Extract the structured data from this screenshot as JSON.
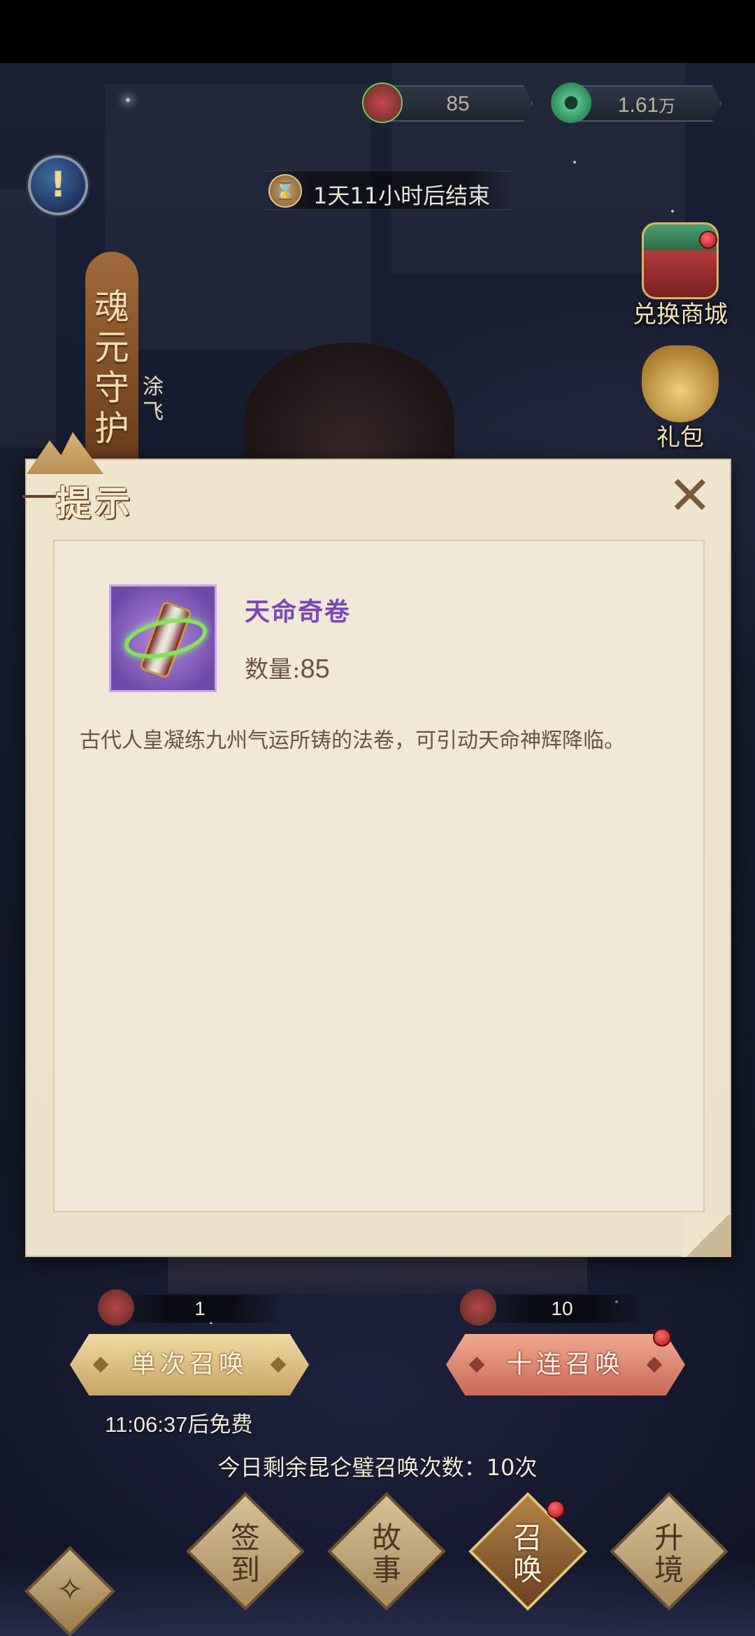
{
  "resources": {
    "scroll_count": "85",
    "jade_amount": "1.61",
    "jade_unit": "万",
    "scroll_icon": "scroll-icon",
    "jade_icon": "jade-coin-icon"
  },
  "info_button": {
    "glyph": "!"
  },
  "event_timer": {
    "text": "1天11小时后结束",
    "icon": "hourglass-icon",
    "icon_glyph": "⌛"
  },
  "side_buttons": {
    "exchange_shop": {
      "label": "兑换商城",
      "icon": "treasure-chest-icon"
    },
    "gift_pack": {
      "label": "礼包",
      "icon": "money-bag-icon"
    }
  },
  "hero": {
    "banner_title": "魂元守护",
    "sub_name": "涂飞"
  },
  "dialog": {
    "title": "提示",
    "close_glyph": "✕",
    "item": {
      "name": "天命奇卷",
      "quantity_label": "数量:",
      "quantity_value": "85",
      "icon": "destiny-scroll-icon",
      "description": "古代人皇凝练九州气运所铸的法卷，可引动天命神辉降临。"
    }
  },
  "summon": {
    "single": {
      "cost": "1",
      "label": "单次召唤",
      "free_timer": "11:06:37后免费"
    },
    "ten": {
      "cost": "10",
      "label": "十连召唤"
    },
    "remaining_text": "今日剩余昆仑璧召唤次数：10次"
  },
  "bottom_nav": {
    "back_glyph": "✧",
    "items": [
      {
        "label_top": "签",
        "label_bottom": "到",
        "active": false
      },
      {
        "label_top": "故",
        "label_bottom": "事",
        "active": false
      },
      {
        "label_top": "召",
        "label_bottom": "唤",
        "active": true
      },
      {
        "label_top": "升",
        "label_bottom": "境",
        "active": false
      }
    ]
  },
  "colors": {
    "accent_gold": "#c9a467",
    "item_name_purple": "#7a48b6",
    "dialog_bg": "#efe4cc",
    "notify_red": "#d9262f"
  }
}
